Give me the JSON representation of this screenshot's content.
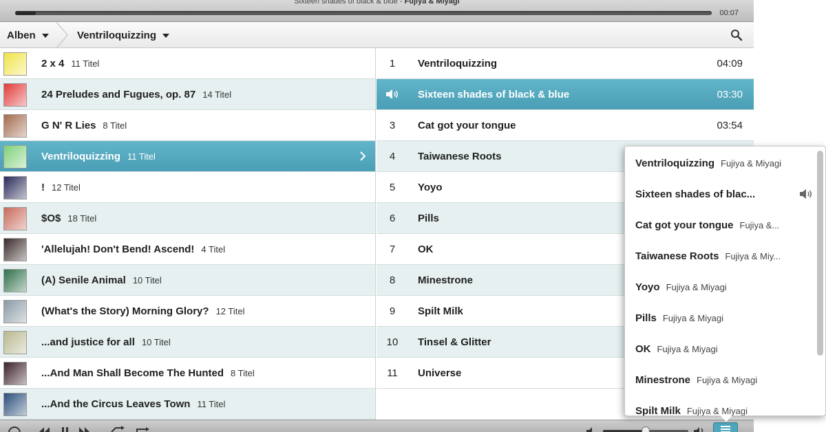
{
  "player": {
    "now_playing_title": "Sixteen shades of black & blue",
    "now_playing_sep": " - ",
    "now_playing_artist": "Fujiya & Miyagi",
    "elapsed": "00:07",
    "progress_fraction": 0.03,
    "volume_fraction": 0.5
  },
  "breadcrumb": {
    "root_label": "Alben",
    "current_label": "Ventriloquizzing"
  },
  "albums": [
    {
      "name": "2 x 4",
      "count": "11 Titel",
      "art": "#f1e44a"
    },
    {
      "name": "24 Preludes and Fugues, op. 87",
      "count": "14 Titel",
      "art": "#e23a3a"
    },
    {
      "name": "G N' R Lies",
      "count": "8 Titel",
      "art": "#a36b4f"
    },
    {
      "name": "Ventriloquizzing",
      "count": "11 Titel",
      "art": "#7fd07a"
    },
    {
      "name": "!",
      "count": "12 Titel",
      "art": "#2a2a5a"
    },
    {
      "name": "$O$",
      "count": "18 Titel",
      "art": "#c86a5a"
    },
    {
      "name": "'Allelujah! Don't Bend! Ascend!",
      "count": "4 Titel",
      "art": "#3b2a2a"
    },
    {
      "name": "(A) Senile Animal",
      "count": "10 Titel",
      "art": "#2f6f4a"
    },
    {
      "name": "(What's the Story) Morning Glory?",
      "count": "12 Titel",
      "art": "#8a9aa6"
    },
    {
      "name": "...and justice for all",
      "count": "10 Titel",
      "art": "#b8b890"
    },
    {
      "name": "...And Man Shall Become The Hunted",
      "count": "8 Titel",
      "art": "#3a1f2a"
    },
    {
      "name": "...And the Circus Leaves Town",
      "count": "11 Titel",
      "art": "#2a4e7a"
    }
  ],
  "tracks": [
    {
      "no": "1",
      "title": "Ventriloquizzing",
      "duration": "04:09"
    },
    {
      "no": "",
      "title": "Sixteen shades of black & blue",
      "duration": "03:30",
      "playing": true
    },
    {
      "no": "3",
      "title": "Cat got your tongue",
      "duration": "03:54"
    },
    {
      "no": "4",
      "title": "Taiwanese Roots",
      "duration": ""
    },
    {
      "no": "5",
      "title": "Yoyo",
      "duration": ""
    },
    {
      "no": "6",
      "title": "Pills",
      "duration": ""
    },
    {
      "no": "7",
      "title": "OK",
      "duration": ""
    },
    {
      "no": "8",
      "title": "Minestrone",
      "duration": ""
    },
    {
      "no": "9",
      "title": "Spilt Milk",
      "duration": ""
    },
    {
      "no": "10",
      "title": "Tinsel & Glitter",
      "duration": ""
    },
    {
      "no": "11",
      "title": "Universe",
      "duration": ""
    }
  ],
  "queue": [
    {
      "title": "Ventriloquizzing",
      "artist": "Fujiya & Miyagi"
    },
    {
      "title": "Sixteen shades of blac...",
      "artist": "",
      "playing": true
    },
    {
      "title": "Cat got your tongue",
      "artist": "Fujiya &..."
    },
    {
      "title": "Taiwanese Roots",
      "artist": "Fujiya & Miy..."
    },
    {
      "title": "Yoyo",
      "artist": "Fujiya & Miyagi"
    },
    {
      "title": "Pills",
      "artist": "Fujiya & Miyagi"
    },
    {
      "title": "OK",
      "artist": "Fujiya & Miyagi"
    },
    {
      "title": "Minestrone",
      "artist": "Fujiya & Miyagi"
    },
    {
      "title": "Spilt Milk",
      "artist": "Fujiya & Miyagi"
    }
  ],
  "selected_album_index": 3,
  "colors": {
    "accent": "#4fa6bd",
    "row_alt": "#e7f0f1"
  }
}
